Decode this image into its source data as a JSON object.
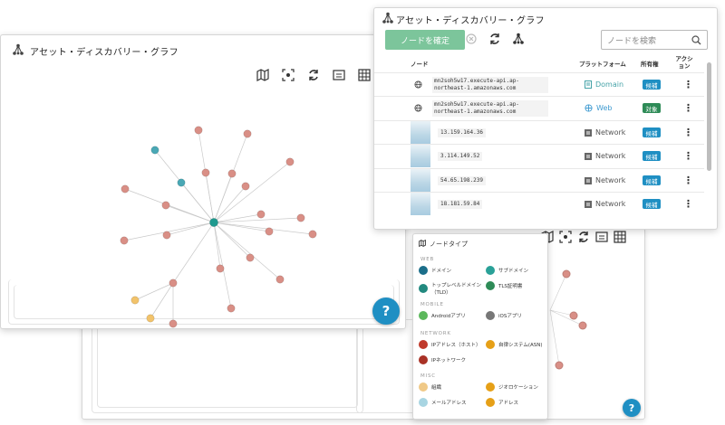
{
  "left_panel": {
    "title": "アセット・ディスカバリー・グラフ",
    "help": "?"
  },
  "table_panel": {
    "title": "アセット・ディスカバリー・グラフ",
    "confirm_button": "ノードを確定",
    "search_placeholder": "ノードを検索",
    "columns": {
      "node": "ノード",
      "platform": "プラットフォーム",
      "owner": "所有権",
      "action": "アクション"
    },
    "rows": [
      {
        "node": "mn2soh5w17.execute-api.ap-northeast-1.amazonaws.com",
        "platform": "Domain",
        "status": "候補",
        "status_color": "#1f8fc3"
      },
      {
        "node": "mn2soh5w17.execute-api.ap-northeast-1.amazonaws.com",
        "platform": "Web",
        "status": "対象",
        "status_color": "#2e8b57"
      },
      {
        "node": "13.159.164.36",
        "platform": "Network",
        "status": "候補",
        "status_color": "#1f8fc3"
      },
      {
        "node": "3.114.149.52",
        "platform": "Network",
        "status": "候補",
        "status_color": "#1f8fc3"
      },
      {
        "node": "54.65.198.239",
        "platform": "Network",
        "status": "候補",
        "status_color": "#1f8fc3"
      },
      {
        "node": "18.181.59.84",
        "platform": "Network",
        "status": "候補",
        "status_color": "#1f8fc3"
      }
    ]
  },
  "legend": {
    "title": "ノードタイプ",
    "sections": [
      {
        "label": "WEB",
        "items": [
          {
            "label": "ドメイン",
            "color": "#1b6e8a"
          },
          {
            "label": "サブドメイン",
            "color": "#2aa198"
          },
          {
            "label": "トップレベルドメイン（TLD）",
            "color": "#22897f"
          },
          {
            "label": "TLS証明書",
            "color": "#2e8b57"
          }
        ]
      },
      {
        "label": "MOBILE",
        "items": [
          {
            "label": "Androidアプリ",
            "color": "#5cb85c"
          },
          {
            "label": "iOSアプリ",
            "color": "#777777"
          }
        ]
      },
      {
        "label": "NETWORK",
        "items": [
          {
            "label": "IPアドレス（ホスト）",
            "color": "#c0392b"
          },
          {
            "label": "自律システム(ASN)",
            "color": "#e6a017"
          },
          {
            "label": "IPネットワーク",
            "color": "#a93226"
          }
        ]
      },
      {
        "label": "MISC",
        "items": [
          {
            "label": "組織",
            "color": "#f0c987"
          },
          {
            "label": "ジオロケーション",
            "color": "#e6a017"
          },
          {
            "label": "メールアドレス",
            "color": "#a8d5e2"
          },
          {
            "label": "アドレス",
            "color": "#e6a017"
          }
        ]
      }
    ]
  },
  "back_panel": {
    "help": "?"
  },
  "colors": {
    "ip_node": "#d98f86",
    "domain_node": "#4aa8b5",
    "center_node": "#1f9a8f",
    "asn_node": "#f2c36b"
  }
}
